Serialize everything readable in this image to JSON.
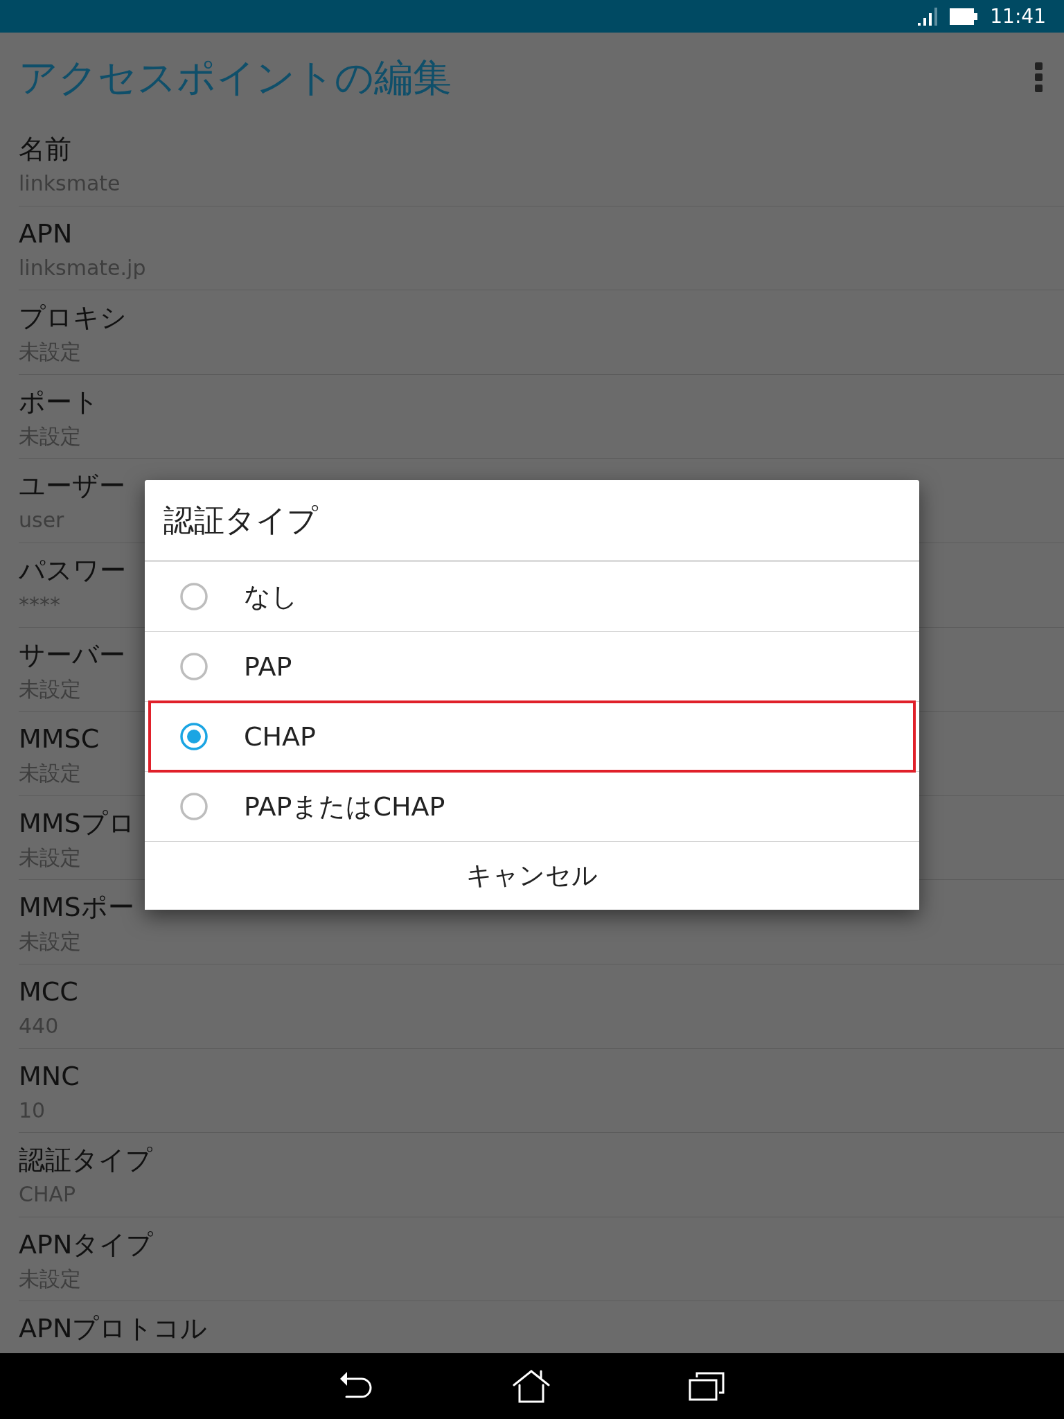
{
  "status_bar": {
    "time": "11:41"
  },
  "app_bar": {
    "title": "アクセスポイントの編集"
  },
  "settings": [
    {
      "label": "名前",
      "value": "linksmate"
    },
    {
      "label": "APN",
      "value": "linksmate.jp"
    },
    {
      "label": "プロキシ",
      "value": "未設定"
    },
    {
      "label": "ポート",
      "value": "未設定"
    },
    {
      "label": "ユーザー",
      "value": "user"
    },
    {
      "label": "パスワー",
      "value": "****"
    },
    {
      "label": "サーバー",
      "value": "未設定"
    },
    {
      "label": "MMSC",
      "value": "未設定"
    },
    {
      "label": "MMSプロ",
      "value": "未設定"
    },
    {
      "label": "MMSポー",
      "value": "未設定"
    },
    {
      "label": "MCC",
      "value": "440"
    },
    {
      "label": "MNC",
      "value": "10"
    },
    {
      "label": "認証タイプ",
      "value": "CHAP"
    },
    {
      "label": "APNタイプ",
      "value": "未設定"
    },
    {
      "label": "APNプロトコル"
    }
  ],
  "dialog": {
    "title": "認証タイプ",
    "options": [
      {
        "label": "なし",
        "selected": false,
        "highlighted": false
      },
      {
        "label": "PAP",
        "selected": false,
        "highlighted": false
      },
      {
        "label": "CHAP",
        "selected": true,
        "highlighted": true
      },
      {
        "label": "PAPまたはCHAP",
        "selected": false,
        "highlighted": false
      }
    ],
    "cancel": "キャンセル"
  }
}
